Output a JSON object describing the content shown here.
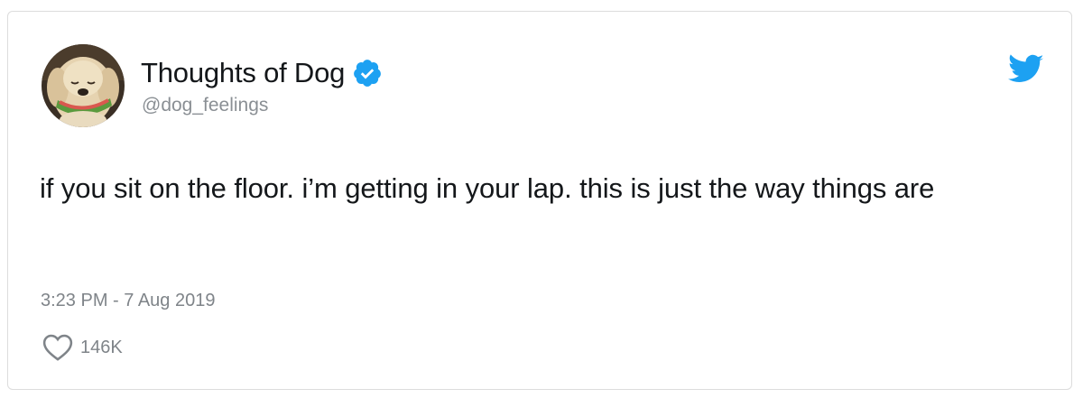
{
  "tweet": {
    "author": {
      "display_name": "Thoughts of Dog",
      "handle": "@dog_feelings",
      "verified": true,
      "avatar_icon": "dog-with-watermelon-avatar"
    },
    "text": "if you sit on the floor. i’m getting in your lap. this is just the way things are",
    "timestamp": "3:23 PM - 7 Aug 2019",
    "like_count": "146K"
  },
  "icons": {
    "verified": "verified-badge-icon",
    "platform": "twitter-bird-icon",
    "like": "heart-icon"
  },
  "colors": {
    "brand_blue": "#1da1f2",
    "text_primary": "#14171a",
    "text_secondary": "#7f8489"
  }
}
